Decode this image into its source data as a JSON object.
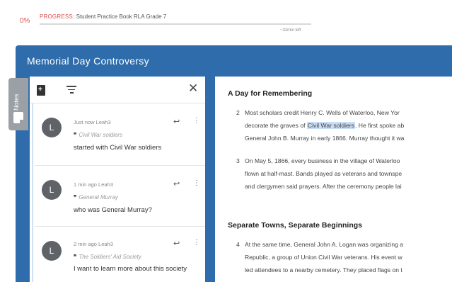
{
  "progress": {
    "percent": "0%",
    "label_prefix": "PROGRESS:",
    "label_book": "Student Practice Book RLA Grade 7",
    "time_left": "~32min left"
  },
  "lesson": {
    "title": "Memorial Day Controversy"
  },
  "notes_tab": {
    "label": "Notes"
  },
  "notes": [
    {
      "avatar": "L",
      "meta": "Just now Leah3",
      "quote": "Civil War soldiers",
      "text": "started with Civil War soldiers"
    },
    {
      "avatar": "L",
      "meta": "1 min ago Leah3",
      "quote": "General Murray",
      "text": "who was General Murray?"
    },
    {
      "avatar": "L",
      "meta": "2 min ago Leah3",
      "quote": "The Soldiers' Aid Society",
      "text": "I want to learn more about this society"
    }
  ],
  "reading": {
    "section1_title": "A Day for Remembering",
    "para2": {
      "num": "2",
      "line1": "Most scholars credit Henry C. Wells of Waterloo, New Yor",
      "line2_pre": "decorate the graves of ",
      "line2_hl": "Civil War soldiers",
      "line2_post": ". He first spoke ab",
      "line3": "General John B. Murray in early 1866. Murray thought it wa"
    },
    "para3": {
      "num": "3",
      "line1": "On May 5, 1866, every business in the village of Waterloo",
      "line2": "flown at half-mast. Bands played as veterans and townspe",
      "line3": "and clergymen said prayers. After the ceremony people lai"
    },
    "section2_title": "Separate Towns, Separate Beginnings",
    "para4": {
      "num": "4",
      "line1": "At the same time, General John A. Logan was organizing a",
      "line2": "Republic, a group of Union Civil War veterans. His event w",
      "line3": "led attendees to a nearby cemetery. They placed flags on t"
    }
  },
  "colors": {
    "primary": "#2e6cab",
    "progress_red": "#d9534f",
    "highlight": "#c8dcf5"
  }
}
